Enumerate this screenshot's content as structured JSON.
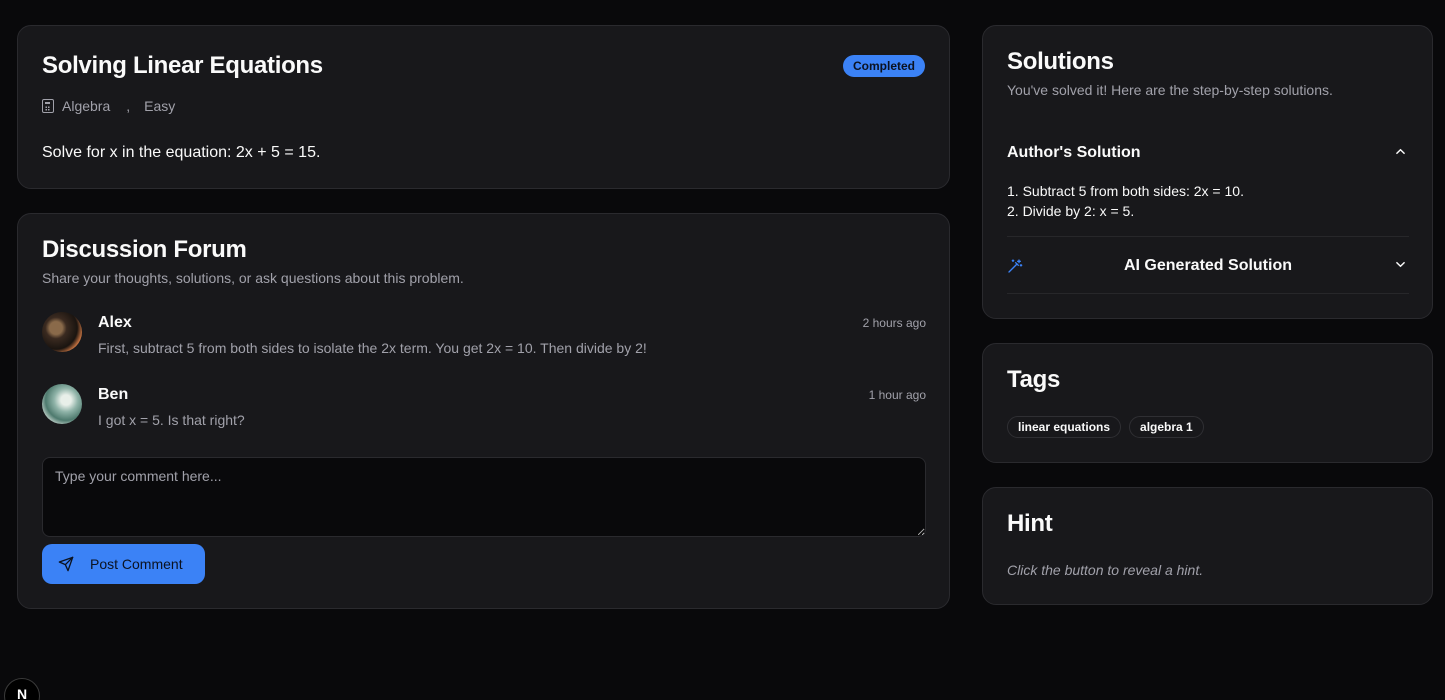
{
  "problem": {
    "title": "Solving Linear Equations",
    "status_badge": "Completed",
    "subject": "Algebra",
    "separator": ",",
    "difficulty": "Easy",
    "statement": "Solve for x in the equation: 2x + 5 = 15."
  },
  "forum": {
    "title": "Discussion Forum",
    "subtitle": "Share your thoughts, solutions, or ask questions about this problem.",
    "comments": [
      {
        "author": "Alex",
        "time": "2 hours ago",
        "text": "First, subtract 5 from both sides to isolate the 2x term. You get 2x = 10. Then divide by 2!"
      },
      {
        "author": "Ben",
        "time": "1 hour ago",
        "text": "I got x = 5. Is that right?"
      }
    ],
    "input_placeholder": "Type your comment here...",
    "post_label": "Post Comment"
  },
  "solutions": {
    "title": "Solutions",
    "subtitle": "You've solved it! Here are the step-by-step solutions.",
    "author_solution": {
      "title": "Author's Solution",
      "steps": [
        "1. Subtract 5 from both sides: 2x = 10.",
        "2. Divide by 2: x = 5."
      ]
    },
    "ai_solution": {
      "title": "AI Generated Solution"
    }
  },
  "tags": {
    "title": "Tags",
    "items": [
      "linear equations",
      "algebra 1"
    ]
  },
  "hint": {
    "title": "Hint",
    "text": "Click the button to reveal a hint."
  },
  "dev_badge": "N",
  "colors": {
    "accent": "#3b82f6",
    "background": "#09090b",
    "card": "#18181b",
    "muted_text": "#a1a1aa"
  }
}
